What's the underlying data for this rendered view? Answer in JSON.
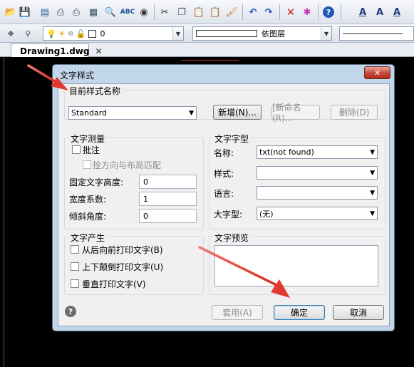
{
  "document_tab": {
    "label": "Drawing1.dwg",
    "close": "✕"
  },
  "toolbar": {
    "icons": [
      "open-icon",
      "save-icon",
      "print-preview-icon",
      "print-icon",
      "print-icon-2",
      "publish-icon",
      "plot-preview-icon",
      "spell-check-icon",
      "find-icon",
      "cut-icon",
      "copy-icon",
      "paste-icon",
      "paste-special-icon",
      "match-properties-icon",
      "undo-icon",
      "redo-icon",
      "erase-icon",
      "explode-icon",
      "help-icon",
      "text-style-icon",
      "text-style-icon-2",
      "text-style-icon-3"
    ],
    "layer_value": "0",
    "linetype_value": "依图层"
  },
  "dialog": {
    "title": "文字样式",
    "close": "✕",
    "current_style_label": "目前样式名称",
    "current_style_value": "Standard",
    "new_button": "新增(N)...",
    "rename_button": "[新命名(R)...",
    "delete_button": "删除(D)",
    "measure_group": "文字测量",
    "annotative_label": "批注",
    "match_layout_label": "拴方向与布局匹配",
    "fixed_height_label": "固定文字高度:",
    "fixed_height_value": "0",
    "width_factor_label": "宽度系数:",
    "width_factor_value": "1",
    "oblique_label": "倾斜角度:",
    "oblique_value": "0",
    "font_group": "文字字型",
    "font_name_label": "名称:",
    "font_name_value": "txt(not found)",
    "font_style_label": "样式:",
    "font_style_value": "",
    "language_label": "语言:",
    "language_value": "",
    "bigfont_label": "大字型:",
    "bigfont_value": "(无)",
    "effects_group": "文字产生",
    "backwards_label": "从后向前打印文字(B)",
    "upside_down_label": "上下颠倒打印文字(U)",
    "vertical_label": "垂直打印文字(V)",
    "preview_group": "文字预览",
    "help": "?",
    "apply_button": "套用(A)",
    "ok_button": "确定",
    "cancel_button": "取消"
  },
  "colors": {
    "annotation_arrow": "#e8453c",
    "dialog_frame": "#c2d6ea",
    "canvas": "#000000"
  }
}
